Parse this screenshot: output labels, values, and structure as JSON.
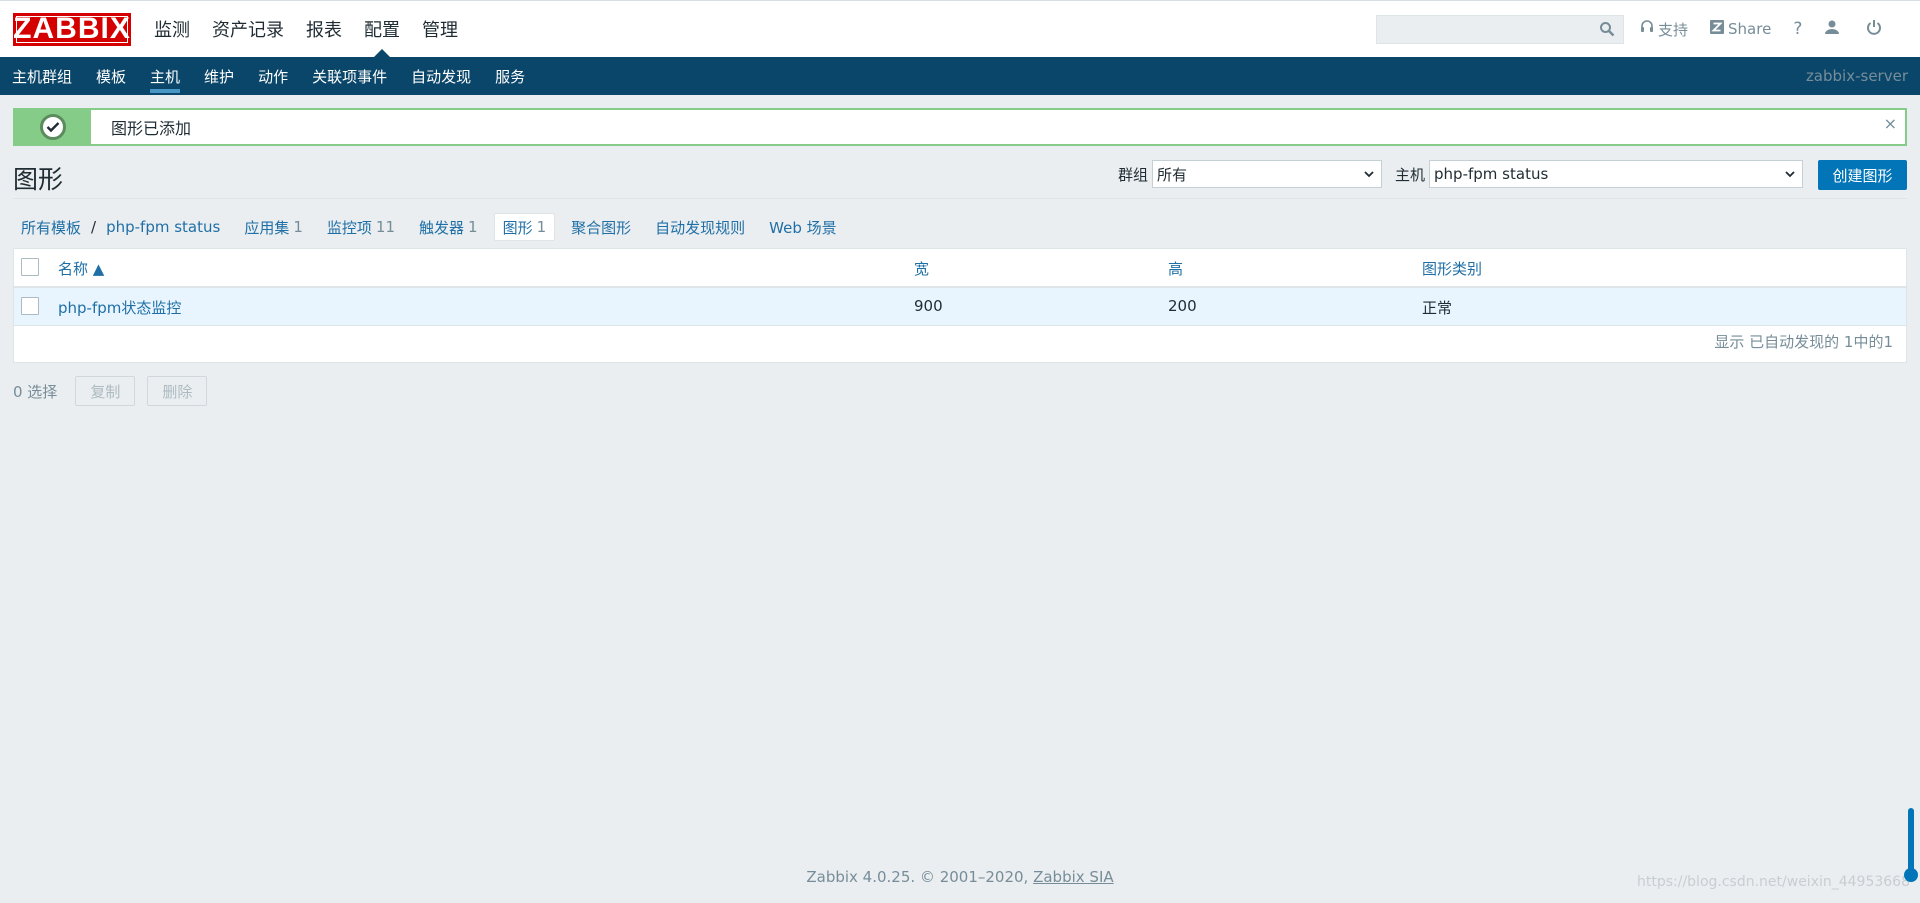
{
  "header": {
    "logo": "ZABBIX",
    "nav": [
      "监测",
      "资产记录",
      "报表",
      "配置",
      "管理"
    ],
    "active_nav": "配置",
    "support": "支持",
    "share": "Share",
    "help": "?"
  },
  "subnav": {
    "items": [
      "主机群组",
      "模板",
      "主机",
      "维护",
      "动作",
      "关联项事件",
      "自动发现",
      "服务"
    ],
    "active": "主机",
    "server": "zabbix-server"
  },
  "message": {
    "text": "图形已添加",
    "close": "×"
  },
  "page": {
    "title": "图形"
  },
  "filters": {
    "group_label": "群组",
    "group_value": "所有",
    "host_label": "主机",
    "host_value": "php-fpm status",
    "create_button": "创建图形"
  },
  "crumbs": {
    "all_templates": "所有模板",
    "sep": "/",
    "host": "php-fpm status",
    "apps": "应用集",
    "apps_n": "1",
    "items": "监控项",
    "items_n": "11",
    "triggers": "触发器",
    "triggers_n": "1",
    "graphs": "图形",
    "graphs_n": "1",
    "screens": "聚合图形",
    "discovery": "自动发现规则",
    "web": "Web 场景"
  },
  "table": {
    "columns": [
      "名称 ▲",
      "宽",
      "高",
      "图形类别"
    ],
    "rows": [
      {
        "name": "php-fpm状态监控",
        "width": "900",
        "height": "200",
        "type": "正常"
      }
    ],
    "footer": "显示 已自动发现的 1中的1"
  },
  "actions": {
    "count": "0 选择",
    "copy": "复制",
    "delete": "删除"
  },
  "footer": {
    "text": "Zabbix 4.0.25. © 2001–2020, ",
    "link": "Zabbix SIA"
  },
  "watermark": "https://blog.csdn.net/weixin_44953668",
  "colors": {
    "brand": "#d40000",
    "subnav": "#0a466a",
    "accent": "#0275b8",
    "success": "#86cc89"
  }
}
